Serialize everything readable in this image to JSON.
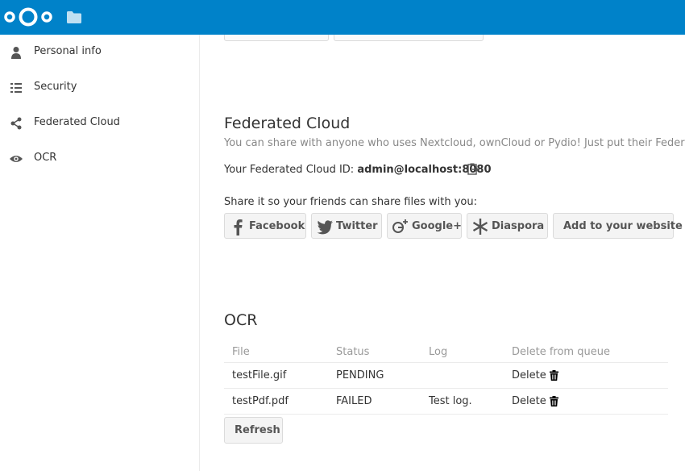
{
  "header": {
    "logo_icon": "nextcloud-logo",
    "files_icon": "folder-icon",
    "color": "#0082c9"
  },
  "sidebar": {
    "items": [
      {
        "label": "Personal info",
        "icon": "person-icon"
      },
      {
        "label": "Security",
        "icon": "list-icon"
      },
      {
        "label": "Federated Cloud",
        "icon": "share-icon"
      },
      {
        "label": "OCR",
        "icon": "eye-icon"
      }
    ]
  },
  "federated": {
    "title": "Federated Cloud",
    "description": "You can share with anyone who uses Nextcloud, ownCloud or Pydio! Just put their Federated Clo",
    "id_label": "Your Federated Cloud ID:",
    "id_value": "admin@localhost:8080",
    "share_prompt": "Share it so your friends can share files with you:",
    "buttons": {
      "facebook": "Facebook",
      "twitter": "Twitter",
      "googleplus": "Google+",
      "diaspora": "Diaspora",
      "website": "Add to your website"
    }
  },
  "ocr": {
    "title": "OCR",
    "columns": [
      "File",
      "Status",
      "Log",
      "Delete from queue"
    ],
    "rows": [
      {
        "file": "testFile.gif",
        "status": "PENDING",
        "log": "",
        "action": "Delete"
      },
      {
        "file": "testPdf.pdf",
        "status": "FAILED",
        "log": "Test log.",
        "action": "Delete"
      }
    ],
    "refresh_label": "Refresh"
  }
}
